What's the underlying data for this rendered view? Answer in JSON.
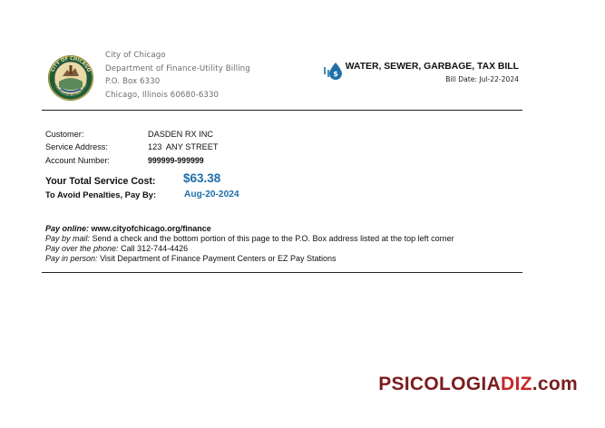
{
  "issuer": {
    "line1": "City of Chicago",
    "line2": "Department of Finance-Utility Billing",
    "line3": "P.O. Box 6330",
    "line4": "Chicago, Illinois 60680-6330",
    "seal_text_top": "CITY OF CHICAGO",
    "seal_text_bottom": "INCORPORATED 4th MARCH 1837"
  },
  "bill": {
    "title": "WATER, SEWER, GARBAGE, TAX BILL",
    "date_label": "Bill Date:",
    "date_value": "Jul-22-2024",
    "icon": "water-drop-dollar-icon"
  },
  "customer": {
    "customer_label": "Customer:",
    "customer_value": "DASDEN RX INC",
    "address_label": "Service Address:",
    "address_value": "123  ANY STREET",
    "account_label": "Account Number:",
    "account_value": "999999-999999"
  },
  "amount": {
    "total_label": "Your Total Service Cost:",
    "total_value": "$63.38",
    "due_label": "To Avoid Penalties, Pay By:",
    "due_value": "Aug-20-2024"
  },
  "payment": {
    "online_label": "Pay online:",
    "online_value": "www.cityofchicago.org/finance",
    "mail_label": "Pay by mail:",
    "mail_value": "Send a check and the bottom portion of this page to the P.O. Box address listed at the top left corner",
    "phone_label": "Pay over the phone:",
    "phone_value": "Call 312-744-4426",
    "person_label": "Pay in person:",
    "person_value": "Visit Department of Finance Payment Centers or EZ Pay Stations"
  },
  "watermark": {
    "part1": "PSICOLOGIA",
    "part2": "DIZ",
    "part3": ".com"
  },
  "colors": {
    "accent_blue": "#1f6fa8",
    "issuer_gray": "#6d6d6d",
    "watermark_dark": "#7b1d1d",
    "watermark_red": "#c62828"
  }
}
